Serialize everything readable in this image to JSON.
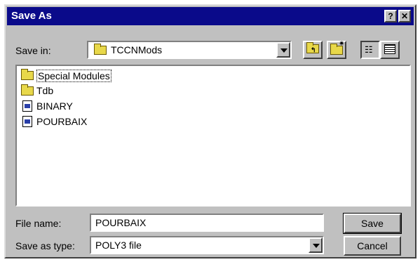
{
  "window": {
    "title": "Save As",
    "help_label": "?",
    "close_label": "✕"
  },
  "save_in": {
    "label": "Save in:",
    "value": "TCCNMods"
  },
  "files": [
    {
      "name": "Special Modules",
      "kind": "folder"
    },
    {
      "name": "Tdb",
      "kind": "folder"
    },
    {
      "name": "BINARY",
      "kind": "file"
    },
    {
      "name": "POURBAIX",
      "kind": "file"
    }
  ],
  "file_name": {
    "label": "File name:",
    "value": "POURBAIX"
  },
  "save_type": {
    "label": "Save as type:",
    "value": "POLY3 file"
  },
  "buttons": {
    "save": "Save",
    "cancel": "Cancel"
  }
}
